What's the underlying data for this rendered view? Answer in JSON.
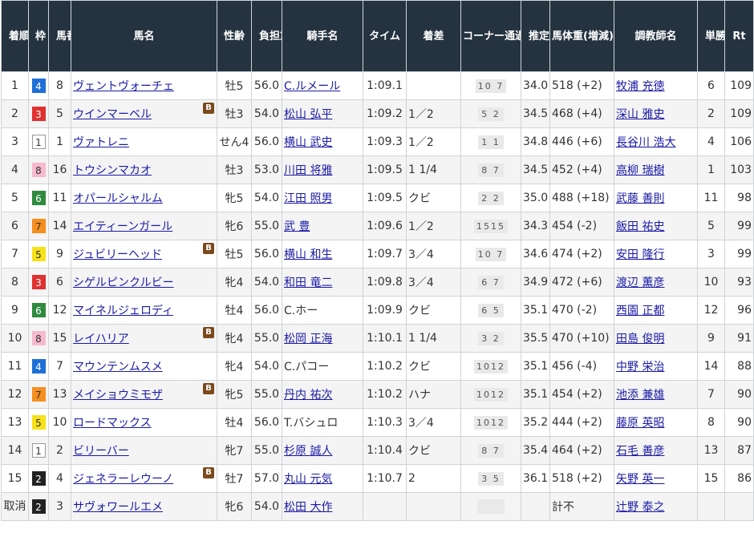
{
  "headers": {
    "chakujun": "着順",
    "waku": "枠",
    "umaban": "馬番",
    "bamei": "馬名",
    "seirei": "性齢",
    "futan": "負担重量",
    "kishu": "騎手名",
    "time": "タイム",
    "chakusa": "着差",
    "corner": "コーナー通過順位",
    "agari": "推定上り",
    "bataiju": "馬体重(増減)",
    "chokyoshi": "調教師名",
    "ninki": "単勝人気",
    "rt": "Rt"
  },
  "blinker_label": "B",
  "waku_colors": {
    "1": "#ffffff",
    "2": "#222222",
    "3": "#e03131",
    "4": "#1f6fd8",
    "5": "#f7e21a",
    "6": "#2f8a3e",
    "7": "#f58f1f",
    "8": "#f7b9cf"
  },
  "rows": [
    {
      "rank": "1",
      "waku": "4",
      "umaban": "8",
      "horse": "ヴェントヴォーチェ",
      "blinker": false,
      "sex_age": "牡5",
      "weight": "56.0",
      "jockey": "C.ルメール",
      "jockey_link": true,
      "time": "1:09.1",
      "margin": "",
      "corner": "10 7",
      "last3f": "34.0",
      "body_weight": "518 (+2)",
      "trainer": "牧浦 充徳",
      "pop": "6",
      "rt": "109"
    },
    {
      "rank": "2",
      "waku": "3",
      "umaban": "5",
      "horse": "ウインマーベル",
      "blinker": true,
      "sex_age": "牡3",
      "weight": "54.0",
      "jockey": "松山 弘平",
      "jockey_link": true,
      "time": "1:09.2",
      "margin": "1／2",
      "corner": "5 2",
      "last3f": "34.5",
      "body_weight": "468 (+4)",
      "trainer": "深山 雅史",
      "pop": "2",
      "rt": "109"
    },
    {
      "rank": "3",
      "waku": "1",
      "umaban": "1",
      "horse": "ヴァトレニ",
      "blinker": false,
      "sex_age": "せん4",
      "weight": "56.0",
      "jockey": "横山 武史",
      "jockey_link": true,
      "time": "1:09.3",
      "margin": "1／2",
      "corner": "1 1",
      "last3f": "34.8",
      "body_weight": "446 (+6)",
      "trainer": "長谷川 浩大",
      "pop": "4",
      "rt": "106"
    },
    {
      "rank": "4",
      "waku": "8",
      "umaban": "16",
      "horse": "トウシンマカオ",
      "blinker": false,
      "sex_age": "牡3",
      "weight": "53.0",
      "jockey": "川田 将雅",
      "jockey_link": true,
      "time": "1:09.5",
      "margin": "1 1/4",
      "corner": "8 7",
      "last3f": "34.5",
      "body_weight": "452 (+4)",
      "trainer": "高柳 瑞樹",
      "pop": "1",
      "rt": "103"
    },
    {
      "rank": "5",
      "waku": "6",
      "umaban": "11",
      "horse": "オパールシャルム",
      "blinker": false,
      "sex_age": "牝5",
      "weight": "54.0",
      "jockey": "江田 照男",
      "jockey_link": true,
      "time": "1:09.5",
      "margin": "クビ",
      "corner": "2 2",
      "last3f": "35.0",
      "body_weight": "488 (+18)",
      "trainer": "武藤 善則",
      "pop": "11",
      "rt": "98"
    },
    {
      "rank": "6",
      "waku": "7",
      "umaban": "14",
      "horse": "エイティーンガール",
      "blinker": false,
      "sex_age": "牝6",
      "weight": "55.0",
      "jockey": "武 豊",
      "jockey_link": true,
      "time": "1:09.6",
      "margin": "1／2",
      "corner": "1515",
      "last3f": "34.3",
      "body_weight": "454 (-2)",
      "trainer": "飯田 祐史",
      "pop": "5",
      "rt": "99"
    },
    {
      "rank": "7",
      "waku": "5",
      "umaban": "9",
      "horse": "ジュビリーヘッド",
      "blinker": true,
      "sex_age": "牡5",
      "weight": "56.0",
      "jockey": "横山 和生",
      "jockey_link": true,
      "time": "1:09.7",
      "margin": "3／4",
      "corner": "10 7",
      "last3f": "34.6",
      "body_weight": "474 (+2)",
      "trainer": "安田 隆行",
      "pop": "3",
      "rt": "99"
    },
    {
      "rank": "8",
      "waku": "3",
      "umaban": "6",
      "horse": "シゲルピンクルビー",
      "blinker": false,
      "sex_age": "牝4",
      "weight": "54.0",
      "jockey": "和田 竜二",
      "jockey_link": true,
      "time": "1:09.8",
      "margin": "3／4",
      "corner": "6 7",
      "last3f": "34.9",
      "body_weight": "472 (+6)",
      "trainer": "渡辺 薫彦",
      "pop": "10",
      "rt": "93"
    },
    {
      "rank": "9",
      "waku": "6",
      "umaban": "12",
      "horse": "マイネルジェロディ",
      "blinker": false,
      "sex_age": "牡4",
      "weight": "56.0",
      "jockey": "C.ホー",
      "jockey_link": false,
      "time": "1:09.9",
      "margin": "クビ",
      "corner": "6 5",
      "last3f": "35.1",
      "body_weight": "470 (-2)",
      "trainer": "西園 正都",
      "pop": "12",
      "rt": "96"
    },
    {
      "rank": "10",
      "waku": "8",
      "umaban": "15",
      "horse": "レイハリア",
      "blinker": true,
      "sex_age": "牝4",
      "weight": "55.0",
      "jockey": "松岡 正海",
      "jockey_link": true,
      "time": "1:10.1",
      "margin": "1 1/4",
      "corner": "3 2",
      "last3f": "35.5",
      "body_weight": "470 (+10)",
      "trainer": "田島 俊明",
      "pop": "9",
      "rt": "91"
    },
    {
      "rank": "11",
      "waku": "4",
      "umaban": "7",
      "horse": "マウンテンムスメ",
      "blinker": false,
      "sex_age": "牝4",
      "weight": "54.0",
      "jockey": "C.パコー",
      "jockey_link": false,
      "time": "1:10.2",
      "margin": "クビ",
      "corner": "1012",
      "last3f": "35.1",
      "body_weight": "456 (-4)",
      "trainer": "中野 栄治",
      "pop": "14",
      "rt": "88"
    },
    {
      "rank": "12",
      "waku": "7",
      "umaban": "13",
      "horse": "メイショウミモザ",
      "blinker": true,
      "sex_age": "牝5",
      "weight": "55.0",
      "jockey": "丹内 祐次",
      "jockey_link": true,
      "time": "1:10.2",
      "margin": "ハナ",
      "corner": "1012",
      "last3f": "35.1",
      "body_weight": "454 (+2)",
      "trainer": "池添 兼雄",
      "pop": "7",
      "rt": "90"
    },
    {
      "rank": "13",
      "waku": "5",
      "umaban": "10",
      "horse": "ロードマックス",
      "blinker": false,
      "sex_age": "牡4",
      "weight": "56.0",
      "jockey": "T.バシュロ",
      "jockey_link": false,
      "time": "1:10.3",
      "margin": "3／4",
      "corner": "1012",
      "last3f": "35.2",
      "body_weight": "444 (+2)",
      "trainer": "藤原 英昭",
      "pop": "8",
      "rt": "90"
    },
    {
      "rank": "14",
      "waku": "1",
      "umaban": "2",
      "horse": "ビリーバー",
      "blinker": false,
      "sex_age": "牝7",
      "weight": "55.0",
      "jockey": "杉原 誠人",
      "jockey_link": true,
      "time": "1:10.4",
      "margin": "クビ",
      "corner": "8 7",
      "last3f": "35.4",
      "body_weight": "464 (+2)",
      "trainer": "石毛 善彦",
      "pop": "13",
      "rt": "87"
    },
    {
      "rank": "15",
      "waku": "2",
      "umaban": "4",
      "horse": "ジェネラーレウーノ",
      "blinker": true,
      "sex_age": "牡7",
      "weight": "57.0",
      "jockey": "丸山 元気",
      "jockey_link": true,
      "time": "1:10.7",
      "margin": "2",
      "corner": "3 5",
      "last3f": "36.1",
      "body_weight": "518 (+2)",
      "trainer": "矢野 英一",
      "pop": "15",
      "rt": "86"
    },
    {
      "rank": "取消",
      "waku": "2",
      "umaban": "3",
      "horse": "サヴォワールエメ",
      "blinker": false,
      "sex_age": "牝6",
      "weight": "54.0",
      "jockey": "松田 大作",
      "jockey_link": true,
      "time": "",
      "margin": "",
      "corner": "",
      "last3f": "",
      "body_weight": "計不",
      "trainer": "辻野 泰之",
      "pop": "",
      "rt": ""
    }
  ]
}
